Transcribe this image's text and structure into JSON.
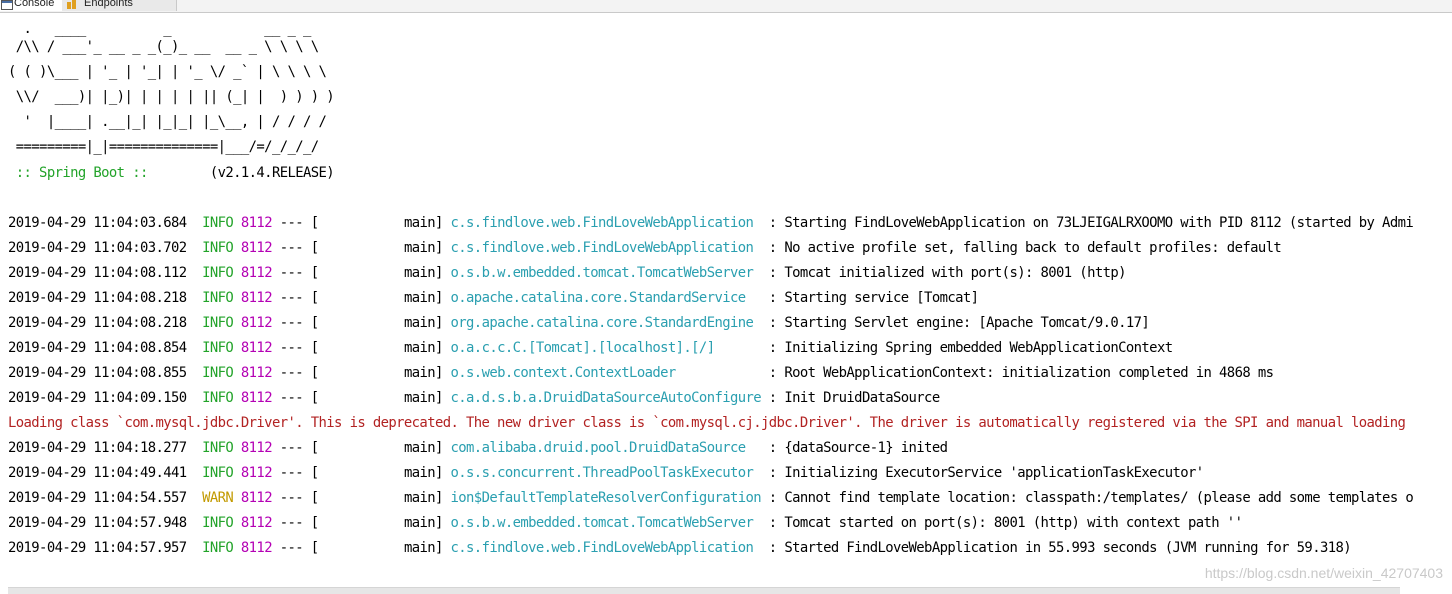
{
  "tabs": [
    {
      "label": "Console",
      "icon": "console-icon"
    },
    {
      "label": "Endpoints",
      "icon": "endpoints-icon"
    }
  ],
  "banner": [
    "  .   ____          _            __ _ _",
    " /\\\\ / ___'_ __ _ _(_)_ __  __ _ \\ \\ \\ \\",
    "( ( )\\___ | '_ | '_| | '_ \\/ _` | \\ \\ \\ \\",
    " \\\\/  ___)| |_)| | | | | || (_| |  ) ) ) )",
    "  '  |____| .__|_| |_|_| |_\\__, | / / / /",
    " =========|_|==============|___/=/_/_/_/"
  ],
  "boot_line": {
    "label": " :: Spring Boot :: ",
    "version": "       (v2.1.4.RELEASE)"
  },
  "log_entries": [
    {
      "ts": "2019-04-29 11:04:03.684",
      "level": "INFO",
      "pid": "8112",
      "sep": " --- [           main] ",
      "logger": "c.s.findlove.web.FindLoveWebApplication ",
      "msg": " : Starting FindLoveWebApplication on 73LJEIGALRXOOMO with PID 8112 (started by Admi"
    },
    {
      "ts": "2019-04-29 11:04:03.702",
      "level": "INFO",
      "pid": "8112",
      "sep": " --- [           main] ",
      "logger": "c.s.findlove.web.FindLoveWebApplication ",
      "msg": " : No active profile set, falling back to default profiles: default"
    },
    {
      "ts": "2019-04-29 11:04:08.112",
      "level": "INFO",
      "pid": "8112",
      "sep": " --- [           main] ",
      "logger": "o.s.b.w.embedded.tomcat.TomcatWebServer ",
      "msg": " : Tomcat initialized with port(s): 8001 (http)"
    },
    {
      "ts": "2019-04-29 11:04:08.218",
      "level": "INFO",
      "pid": "8112",
      "sep": " --- [           main] ",
      "logger": "o.apache.catalina.core.StandardService  ",
      "msg": " : Starting service [Tomcat]"
    },
    {
      "ts": "2019-04-29 11:04:08.218",
      "level": "INFO",
      "pid": "8112",
      "sep": " --- [           main] ",
      "logger": "org.apache.catalina.core.StandardEngine ",
      "msg": " : Starting Servlet engine: [Apache Tomcat/9.0.17]"
    },
    {
      "ts": "2019-04-29 11:04:08.854",
      "level": "INFO",
      "pid": "8112",
      "sep": " --- [           main] ",
      "logger": "o.a.c.c.C.[Tomcat].[localhost].[/]      ",
      "msg": " : Initializing Spring embedded WebApplicationContext"
    },
    {
      "ts": "2019-04-29 11:04:08.855",
      "level": "INFO",
      "pid": "8112",
      "sep": " --- [           main] ",
      "logger": "o.s.web.context.ContextLoader           ",
      "msg": " : Root WebApplicationContext: initialization completed in 4868 ms"
    },
    {
      "ts": "2019-04-29 11:04:09.150",
      "level": "INFO",
      "pid": "8112",
      "sep": " --- [           main] ",
      "logger": "c.a.d.s.b.a.DruidDataSourceAutoConfigure",
      "msg": " : Init DruidDataSource"
    }
  ],
  "deprecation_warning": "Loading class `com.mysql.jdbc.Driver'. This is deprecated. The new driver class is `com.mysql.cj.jdbc.Driver'. The driver is automatically registered via the SPI and manual loading",
  "log_entries_after": [
    {
      "ts": "2019-04-29 11:04:18.277",
      "level": "INFO",
      "pid": "8112",
      "sep": " --- [           main] ",
      "logger": "com.alibaba.druid.pool.DruidDataSource  ",
      "msg": " : {dataSource-1} inited"
    },
    {
      "ts": "2019-04-29 11:04:49.441",
      "level": "INFO",
      "pid": "8112",
      "sep": " --- [           main] ",
      "logger": "o.s.s.concurrent.ThreadPoolTaskExecutor ",
      "msg": " : Initializing ExecutorService 'applicationTaskExecutor'"
    },
    {
      "ts": "2019-04-29 11:04:54.557",
      "level": "WARN",
      "pid": "8112",
      "sep": " --- [           main] ",
      "logger": "ion$DefaultTemplateResolverConfiguration",
      "msg": " : Cannot find template location: classpath:/templates/ (please add some templates o"
    },
    {
      "ts": "2019-04-29 11:04:57.948",
      "level": "INFO",
      "pid": "8112",
      "sep": " --- [           main] ",
      "logger": "o.s.b.w.embedded.tomcat.TomcatWebServer ",
      "msg": " : Tomcat started on port(s): 8001 (http) with context path ''"
    },
    {
      "ts": "2019-04-29 11:04:57.957",
      "level": "INFO",
      "pid": "8112",
      "sep": " --- [           main] ",
      "logger": "c.s.findlove.web.FindLoveWebApplication ",
      "msg": " : Started FindLoveWebApplication in 55.993 seconds (JVM running for 59.318)"
    }
  ],
  "watermark": "https://blog.csdn.net/weixin_42707403",
  "colors": {
    "info": "#22a329",
    "warn": "#c29a00",
    "pid": "#b400b4",
    "logger": "#2a9fb0",
    "error": "#b22222"
  }
}
